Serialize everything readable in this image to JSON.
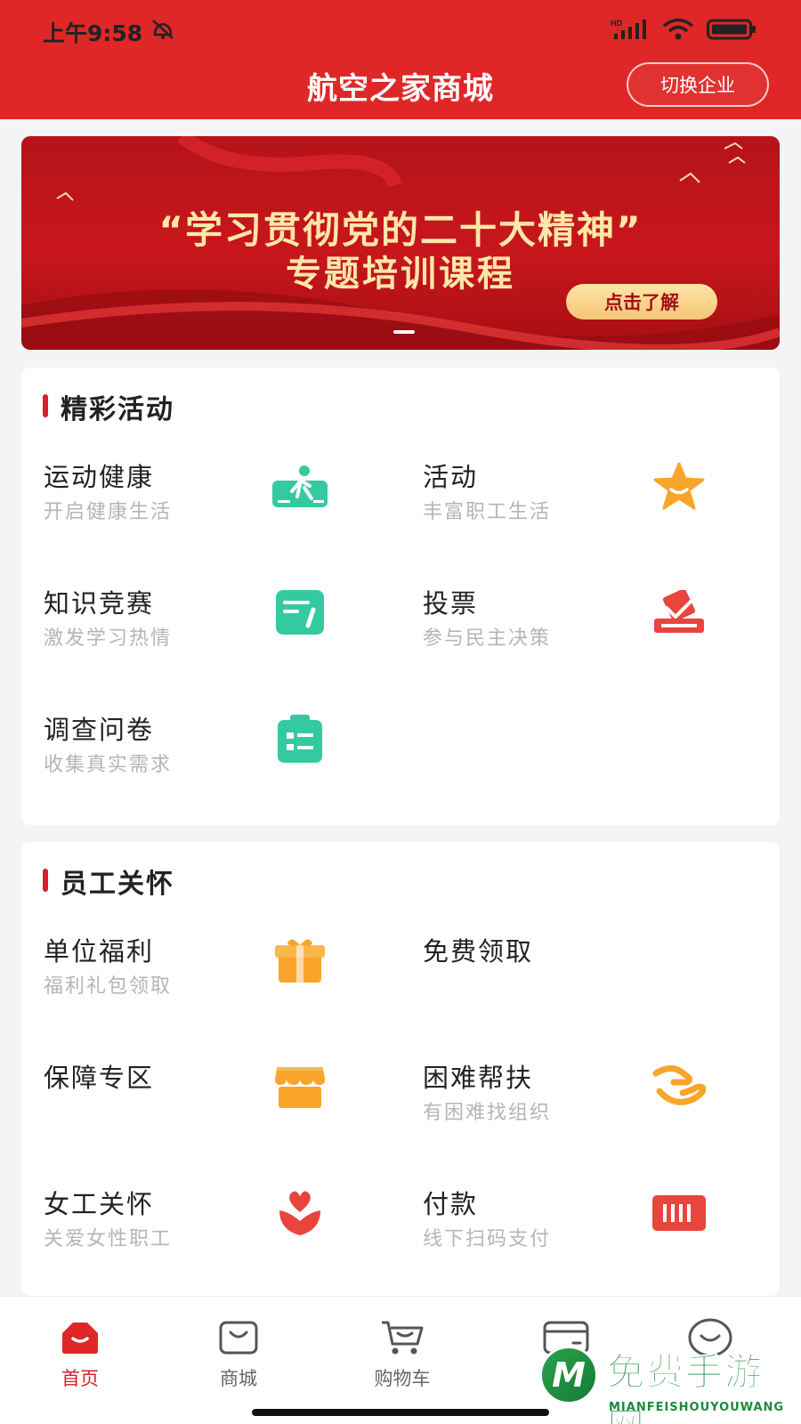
{
  "status": {
    "time": "上午9:58"
  },
  "header": {
    "title": "航空之家商城",
    "switch_label": "切换企业"
  },
  "banner": {
    "line1": "“学习贯彻党的二十大精神”",
    "line2": "专题培训课程",
    "button": "点击了解"
  },
  "activities": {
    "title": "精彩活动",
    "items": [
      {
        "title": "运动健康",
        "subtitle": "开启健康生活",
        "icon": "running-icon"
      },
      {
        "title": "活动",
        "subtitle": "丰富职工生活",
        "icon": "star-icon"
      },
      {
        "title": "知识竞赛",
        "subtitle": "激发学习热情",
        "icon": "quiz-icon"
      },
      {
        "title": "投票",
        "subtitle": "参与民主决策",
        "icon": "vote-icon"
      },
      {
        "title": "调查问卷",
        "subtitle": "收集真实需求",
        "icon": "clipboard-icon"
      }
    ]
  },
  "care": {
    "title": "员工关怀",
    "items": [
      {
        "title": "单位福利",
        "subtitle": "福利礼包领取",
        "icon": "gift-icon"
      },
      {
        "title": "免费领取",
        "subtitle": "",
        "icon": ""
      },
      {
        "title": "保障专区",
        "subtitle": "",
        "icon": "store-icon"
      },
      {
        "title": "困难帮扶",
        "subtitle": "有困难找组织",
        "icon": "helping-hand-icon"
      },
      {
        "title": "女工关怀",
        "subtitle": "关爱女性职工",
        "icon": "heart-flower-icon"
      },
      {
        "title": "付款",
        "subtitle": "线下扫码支付",
        "icon": "barcode-icon"
      }
    ]
  },
  "tabbar": {
    "items": [
      {
        "label": "首页",
        "icon": "home-icon",
        "active": true
      },
      {
        "label": "商城",
        "icon": "shopping-bag-icon",
        "active": false
      },
      {
        "label": "购物车",
        "icon": "cart-icon",
        "active": false
      },
      {
        "label": "",
        "icon": "wallet-icon",
        "active": false
      },
      {
        "label": "",
        "icon": "smile-icon",
        "active": false
      }
    ]
  },
  "watermark": {
    "text": "免费手游网",
    "sub": "MIANFEISHOUYOUWANG",
    "logo": "M"
  },
  "colors": {
    "brand": "#e02727",
    "accent_red": "#d81e2a",
    "green": "#2ecc9a",
    "orange": "#f9a42a",
    "gold": "#ffe7a8"
  }
}
